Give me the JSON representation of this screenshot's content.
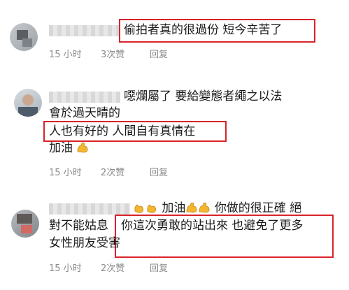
{
  "comments": [
    {
      "text1": "偷拍者真的很過份 短今辛苦了",
      "time": "15 小时",
      "likes": "3次赞",
      "reply": "回复"
    },
    {
      "line1": "噁爛屬了 要給變態者繩之以法",
      "line2": "會於過天晴的",
      "line3": "人也有好的 人間自有真情在",
      "line4": "加油",
      "time": "15 小时",
      "likes": "2次赞",
      "reply": "回复"
    },
    {
      "line1_mid": "加油",
      "line1_end": "你做的很正確 絕",
      "line2_start": "對不能姑息",
      "line2_hl": "你這次勇敢的站出來 也避免了更多",
      "line3": "女性朋友受害",
      "time": "15 小时",
      "likes": "2次赞",
      "reply": "回复"
    }
  ],
  "colors": {
    "highlight": "#d9232a",
    "meta": "#8a8a8a",
    "emoji": "#f2b630"
  }
}
